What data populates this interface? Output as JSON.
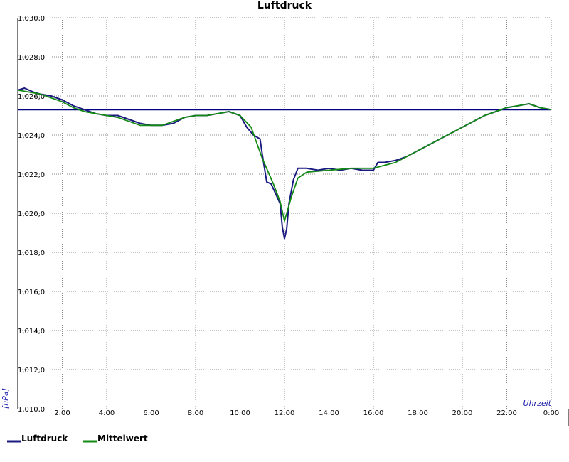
{
  "chart_data": {
    "type": "line",
    "title": "Luftdruck",
    "ylabel": "[hPa]",
    "xlabel": "Uhrzeit",
    "ylim": [
      1010,
      1030
    ],
    "xlim": [
      0,
      24
    ],
    "y_ticks": [
      1010,
      1012,
      1014,
      1016,
      1018,
      1020,
      1022,
      1024,
      1026,
      1028,
      1030
    ],
    "y_tick_labels": [
      "1,010,0",
      "1,012,0",
      "1,014,0",
      "1,016,0",
      "1,018,0",
      "1,020,0",
      "1,022,0",
      "1,024,0",
      "1,026,0",
      "1,028,0",
      "1,030,0"
    ],
    "x_ticks": [
      2,
      4,
      6,
      8,
      10,
      12,
      14,
      16,
      18,
      20,
      22,
      24
    ],
    "x_tick_labels": [
      "2:00",
      "4:00",
      "6:00",
      "8:00",
      "10:00",
      "12:00",
      "14:00",
      "16:00",
      "18:00",
      "20:00",
      "22:00",
      "0:00"
    ],
    "grid": true,
    "legend_position": "bottom-left",
    "reference_line": {
      "y": 1025.3,
      "color": "#000080"
    },
    "series": [
      {
        "name": "Luftdruck",
        "color": "#1a1a80",
        "x": [
          0,
          0.3,
          0.7,
          1.0,
          1.5,
          2.0,
          2.5,
          3.0,
          3.5,
          4.0,
          4.5,
          5.0,
          5.5,
          6.0,
          6.5,
          7.0,
          7.5,
          8.0,
          8.5,
          9.0,
          9.5,
          10.0,
          10.3,
          10.6,
          10.9,
          11.0,
          11.2,
          11.4,
          11.6,
          11.8,
          11.9,
          12.0,
          12.1,
          12.2,
          12.4,
          12.6,
          13.0,
          13.5,
          14.0,
          14.5,
          15.0,
          15.5,
          16.0,
          16.2,
          16.5,
          17.0,
          17.5,
          18.0,
          18.5,
          19.0,
          19.5,
          20.0,
          20.5,
          21.0,
          21.5,
          22.0,
          22.5,
          23.0,
          23.5,
          24.0
        ],
        "y": [
          1026.3,
          1026.4,
          1026.2,
          1026.1,
          1026.0,
          1025.8,
          1025.5,
          1025.3,
          1025.1,
          1025.0,
          1025.0,
          1024.8,
          1024.6,
          1024.5,
          1024.5,
          1024.6,
          1024.9,
          1025.0,
          1025.0,
          1025.1,
          1025.2,
          1025.0,
          1024.4,
          1024.0,
          1023.8,
          1023.0,
          1021.6,
          1021.5,
          1021.0,
          1020.5,
          1019.3,
          1018.7,
          1019.2,
          1020.5,
          1021.7,
          1022.3,
          1022.3,
          1022.2,
          1022.3,
          1022.2,
          1022.3,
          1022.2,
          1022.2,
          1022.6,
          1022.6,
          1022.7,
          1022.9,
          1023.2,
          1023.5,
          1023.8,
          1024.1,
          1024.4,
          1024.7,
          1025.0,
          1025.2,
          1025.4,
          1025.5,
          1025.6,
          1025.4,
          1025.3
        ]
      },
      {
        "name": "Mittelwert",
        "color": "#138a13",
        "x": [
          0,
          0.5,
          1.0,
          1.5,
          2.0,
          2.5,
          3.0,
          3.5,
          4.0,
          4.5,
          5.0,
          5.5,
          6.0,
          6.5,
          7.0,
          7.5,
          8.0,
          8.5,
          9.0,
          9.5,
          10.0,
          10.5,
          11.0,
          11.5,
          11.8,
          12.0,
          12.3,
          12.6,
          13.0,
          14.0,
          15.0,
          16.0,
          17.0,
          18.0,
          19.0,
          20.0,
          21.0,
          22.0,
          22.5,
          23.0,
          23.5,
          24.0
        ],
        "y": [
          1026.3,
          1026.2,
          1026.1,
          1025.9,
          1025.7,
          1025.4,
          1025.2,
          1025.1,
          1025.0,
          1024.9,
          1024.7,
          1024.5,
          1024.5,
          1024.5,
          1024.7,
          1024.9,
          1025.0,
          1025.0,
          1025.1,
          1025.2,
          1025.0,
          1024.4,
          1022.8,
          1021.5,
          1020.6,
          1019.6,
          1020.8,
          1021.8,
          1022.1,
          1022.2,
          1022.3,
          1022.3,
          1022.6,
          1023.2,
          1023.8,
          1024.4,
          1025.0,
          1025.4,
          1025.5,
          1025.6,
          1025.4,
          1025.3
        ]
      }
    ]
  }
}
